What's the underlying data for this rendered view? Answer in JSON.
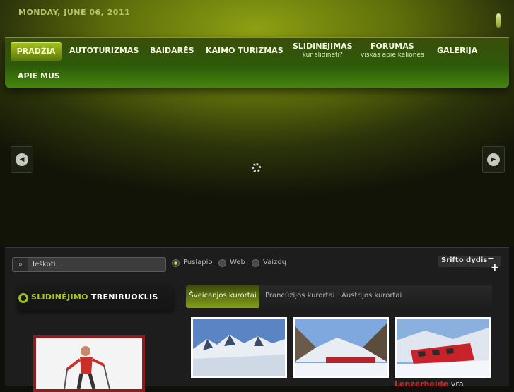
{
  "header": {
    "date": "MONDAY, JUNE 06, 2011"
  },
  "nav": {
    "items": [
      {
        "label": "PRADŽIA",
        "sub": "",
        "active": true
      },
      {
        "label": "AUTOTURIZMAS",
        "sub": ""
      },
      {
        "label": "BAIDARĖS",
        "sub": ""
      },
      {
        "label": "KAIMO TURIZMAS",
        "sub": ""
      },
      {
        "label": "SLIDINĖJIMAS",
        "sub": "kur slidinėti?"
      },
      {
        "label": "FORUMAS",
        "sub": "viskas apie keliones"
      },
      {
        "label": "GALERIJA",
        "sub": ""
      },
      {
        "label": "APIE MUS",
        "sub": ""
      }
    ]
  },
  "slider": {
    "prev_icon": "arrow-left-icon",
    "next_icon": "arrow-right-icon",
    "loading_icon": "spinner-icon"
  },
  "search": {
    "placeholder": "Ieškoti...",
    "button_icon": "search-icon",
    "options": [
      {
        "label": "Puslapio",
        "selected": true
      },
      {
        "label": "Web",
        "selected": false
      },
      {
        "label": "Vaizdų",
        "selected": false
      }
    ]
  },
  "font_size": {
    "label": "Šrifto dydis",
    "minus": "−",
    "plus": "+"
  },
  "module": {
    "title_highlight": "SLIDINĖJIMO",
    "title_rest": "TRENIRUOKLIS"
  },
  "tabs": [
    {
      "label": "Šveicanjos kurortai",
      "active": true
    },
    {
      "label": "Prancūzijos kurortai",
      "active": false
    },
    {
      "label": "Austrijos kurortai",
      "active": false
    }
  ],
  "thumbs": {
    "caption_red": "Lenzerheide",
    "caption_rest": "vra"
  },
  "colors": {
    "accent": "#9fbf19",
    "nav_bg": "#2c5a08",
    "content_bg": "#1d1d1d",
    "caption_red": "#d02525"
  }
}
